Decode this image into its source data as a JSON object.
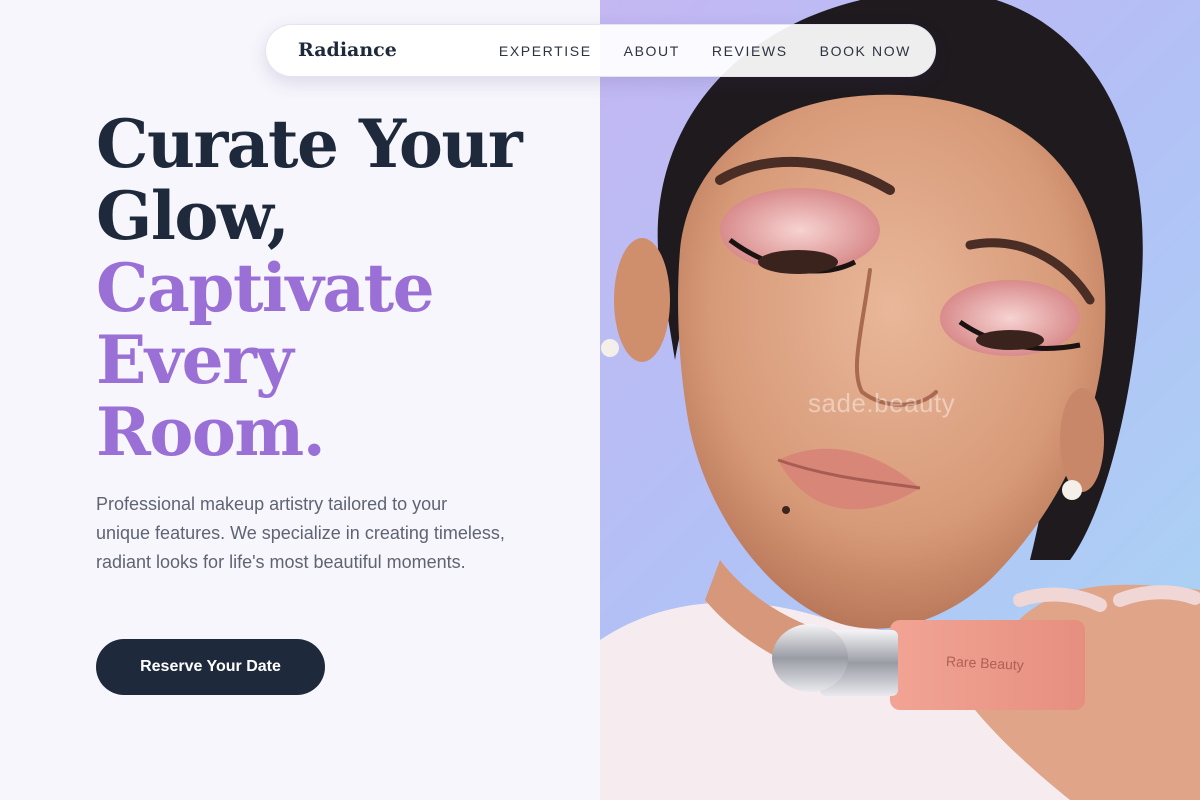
{
  "nav": {
    "brand": "Radiance",
    "links": [
      {
        "label": "EXPERTISE"
      },
      {
        "label": "ABOUT"
      },
      {
        "label": "REVIEWS"
      },
      {
        "label": "BOOK NOW"
      }
    ]
  },
  "hero": {
    "headline_lines": [
      "Curate Your",
      "Glow,"
    ],
    "headline_accent_lines": [
      "Captivate",
      "Every",
      "Room."
    ],
    "description": "Professional makeup artistry tailored to your unique features. We specialize in creating timeless, radiant looks for life's most beautiful moments.",
    "cta_label": "Reserve Your Date"
  },
  "photo": {
    "watermark": "sade.beauty",
    "product_label": "Rare Beauty"
  },
  "colors": {
    "page_bg": "#f7f6fc",
    "navy": "#1e2a3b",
    "accent_purple": "#9a6fd6",
    "body_text": "#5f6472"
  }
}
